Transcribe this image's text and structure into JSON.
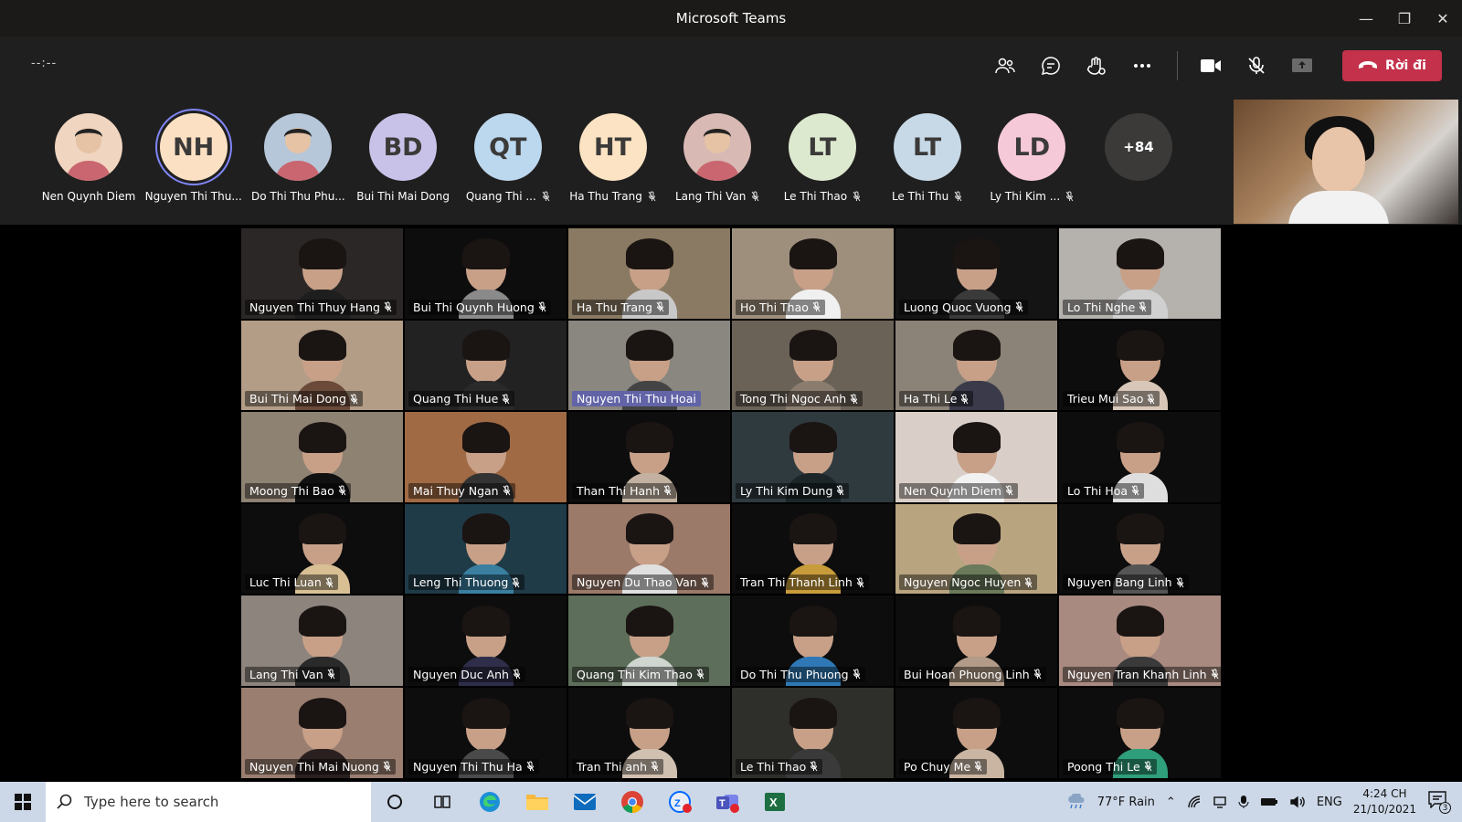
{
  "window": {
    "title": "Microsoft Teams"
  },
  "toolbar": {
    "timer": "--:--",
    "leave_label": "Rời đi"
  },
  "strip": {
    "participants": [
      {
        "name": "Nen Quynh Diem",
        "initials": "",
        "color": "#f0d5c0",
        "muted": false
      },
      {
        "name": "Nguyen Thi Thu...",
        "initials": "NH",
        "color": "#fbe0c3",
        "muted": false
      },
      {
        "name": "Do Thi Thu Phu...",
        "initials": "",
        "color": "#b6c7d9",
        "muted": false
      },
      {
        "name": "Bui Thi Mai Dong",
        "initials": "BD",
        "color": "#c9c2e8",
        "muted": false
      },
      {
        "name": "Quang Thi ...",
        "initials": "QT",
        "color": "#bcd8ef",
        "muted": true
      },
      {
        "name": "Ha Thu Trang",
        "initials": "HT",
        "color": "#fbe3c3",
        "muted": true
      },
      {
        "name": "Lang Thi Van",
        "initials": "",
        "color": "#d8b9b4",
        "muted": true
      },
      {
        "name": "Le Thi Thao",
        "initials": "LT",
        "color": "#dde9cf",
        "muted": true
      },
      {
        "name": "Le Thi Thu",
        "initials": "LT",
        "color": "#c7d9e6",
        "muted": true
      },
      {
        "name": "Ly Thi Kim ...",
        "initials": "LD",
        "color": "#f6c9d9",
        "muted": true
      }
    ],
    "more_count": "+84"
  },
  "grid": {
    "tiles": [
      {
        "name": "Nguyen Thi Thuy Hang",
        "bg": "#2b2726",
        "shirt": "#1e1e1e",
        "hl": false
      },
      {
        "name": "Bui Thi Quynh Huong",
        "bg": "#0d0d0d",
        "shirt": "#8a8a8a",
        "hl": false
      },
      {
        "name": "Ha Thu Trang",
        "bg": "#8a7a63",
        "shirt": "#c8c8c8",
        "hl": false
      },
      {
        "name": "Ho Thi Thao",
        "bg": "#9e8f7d",
        "shirt": "#f0f0f0",
        "hl": false
      },
      {
        "name": "Luong Quoc Vuong",
        "bg": "#141414",
        "shirt": "#3a3a3a",
        "hl": false
      },
      {
        "name": "Lo Thi Nghe",
        "bg": "#b5b1ad",
        "shirt": "#d0d0d0",
        "hl": false
      },
      {
        "name": "Bui Thi Mai Dong",
        "bg": "#b39d87",
        "shirt": "#6b4a3a",
        "hl": false
      },
      {
        "name": "Quang Thi Hue",
        "bg": "#222",
        "shirt": "#2a2a2a",
        "hl": false
      },
      {
        "name": "Nguyen Thi Thu Hoai",
        "bg": "#8a8680",
        "shirt": "#444",
        "hl": true
      },
      {
        "name": "Tong Thi Ngoc Anh",
        "bg": "#6b6257",
        "shirt": "#8a7d70",
        "hl": false
      },
      {
        "name": "Ha Thi Le",
        "bg": "#8c8378",
        "shirt": "#3a3a4a",
        "hl": false
      },
      {
        "name": "Trieu Mui Sao",
        "bg": "#0d0d0d",
        "shirt": "#d8c7b8",
        "hl": false
      },
      {
        "name": "Moong Thi Bao",
        "bg": "#8e8273",
        "shirt": "#111",
        "hl": false
      },
      {
        "name": "Mai Thuy Ngan",
        "bg": "#a06a44",
        "shirt": "#333",
        "hl": false
      },
      {
        "name": "Than Thi Hanh",
        "bg": "#0d0d0d",
        "shirt": "#c2b1a0",
        "hl": false
      },
      {
        "name": "Ly Thi Kim Dung",
        "bg": "#2f3a3f",
        "shirt": "#1c2629",
        "hl": false
      },
      {
        "name": "Nen Quynh Diem",
        "bg": "#d9cfc8",
        "shirt": "#f2f2f2",
        "hl": false
      },
      {
        "name": "Lo Thi Hoa",
        "bg": "#0d0d0d",
        "shirt": "#dedede",
        "hl": false
      },
      {
        "name": "Luc Thi Luan",
        "bg": "#0d0d0d",
        "shirt": "#d8c094",
        "hl": false
      },
      {
        "name": "Leng Thi Thuong",
        "bg": "#1f3b47",
        "shirt": "#3a7fa0",
        "hl": false
      },
      {
        "name": "Nguyen Du Thao Van",
        "bg": "#9b7a6a",
        "shirt": "#e0e0e0",
        "hl": false
      },
      {
        "name": "Tran Thi Thanh Linh",
        "bg": "#0d0d0d",
        "shirt": "#c89c3a",
        "hl": false
      },
      {
        "name": "Nguyen Ngoc Huyen",
        "bg": "#b8a580",
        "shirt": "#6a7a5a",
        "hl": false
      },
      {
        "name": "Nguyen Bang Linh",
        "bg": "#0d0d0d",
        "shirt": "#555",
        "hl": false
      },
      {
        "name": "Lang Thi Van",
        "bg": "#8c847d",
        "shirt": "#2a2a2a",
        "hl": false
      },
      {
        "name": "Nguyen Duc Anh",
        "bg": "#0d0d0d",
        "shirt": "#2e2e4a",
        "hl": false
      },
      {
        "name": "Quang Thi Kim Thao",
        "bg": "#5d6e5a",
        "shirt": "#cfd5cf",
        "hl": false
      },
      {
        "name": "Do Thi Thu Phuong",
        "bg": "#0d0d0d",
        "shirt": "#2f78b5",
        "hl": false
      },
      {
        "name": "Bui Hoan Phuong Linh",
        "bg": "#0d0d0d",
        "shirt": "#b29b88",
        "hl": false
      },
      {
        "name": "Nguyen Tran Khanh Linh",
        "bg": "#a88a80",
        "shirt": "#3a3a3a",
        "hl": false
      },
      {
        "name": "Nguyen Thi Mai Nuong",
        "bg": "#9a7e70",
        "shirt": "#2a2020",
        "hl": false
      },
      {
        "name": "Nguyen Thi Thu Ha",
        "bg": "#0d0d0d",
        "shirt": "#4a4a4a",
        "hl": false
      },
      {
        "name": "Tran Thi anh",
        "bg": "#0d0d0d",
        "shirt": "#d0c0b0",
        "hl": false
      },
      {
        "name": "Le Thi Thao",
        "bg": "#2e2f2a",
        "shirt": "#3a3a3a",
        "hl": false
      },
      {
        "name": "Po Chuy Me",
        "bg": "#0d0d0d",
        "shirt": "#c9b5a2",
        "hl": false
      },
      {
        "name": "Poong Thi Le",
        "bg": "#0d0d0d",
        "shirt": "#2f9e7a",
        "hl": false
      }
    ]
  },
  "taskbar": {
    "search_placeholder": "Type here to search",
    "weather": "77°F  Rain",
    "language": "ENG",
    "time": "4:24 CH",
    "date": "21/10/2021",
    "notification_count": "3"
  }
}
